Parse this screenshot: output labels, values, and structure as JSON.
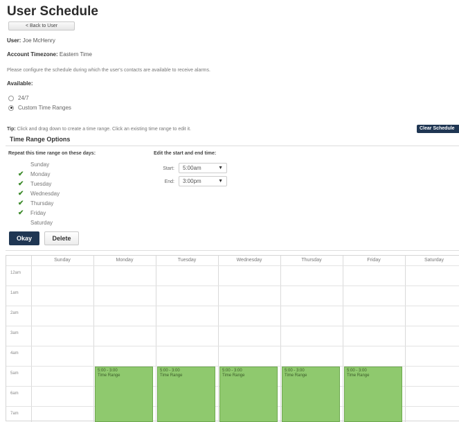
{
  "page": {
    "title": "User Schedule",
    "back_label": "< Back to User",
    "user_label": "User:",
    "user_name": "Joe McHenry",
    "timezone_label": "Account Timezone:",
    "timezone_value": "Eastern Time",
    "description": "Please configure the schedule during which the user's contacts are available to receive alarms.",
    "available_label": "Available:",
    "options": [
      {
        "label": "24/7",
        "selected": false
      },
      {
        "label": "Custom Time Ranges",
        "selected": true
      }
    ]
  },
  "tip": {
    "label": "Tip:",
    "text": "Click and drag down to create a time range. Click an existing time range to edit it.",
    "clear_button": "Clear Schedule"
  },
  "time_range_options": {
    "title": "Time Range Options",
    "repeat_heading": "Repeat this time range on these days:",
    "days": [
      {
        "label": "Sunday",
        "checked": false
      },
      {
        "label": "Monday",
        "checked": true
      },
      {
        "label": "Tuesday",
        "checked": true
      },
      {
        "label": "Wednesday",
        "checked": true
      },
      {
        "label": "Thursday",
        "checked": true
      },
      {
        "label": "Friday",
        "checked": true
      },
      {
        "label": "Saturday",
        "checked": false
      }
    ],
    "edit_heading": "Edit the start and end time:",
    "start_label": "Start:",
    "start_value": "5:00am",
    "end_label": "End:",
    "end_value": "3:00pm",
    "okay_label": "Okay",
    "delete_label": "Delete"
  },
  "calendar": {
    "columns": [
      "Sunday",
      "Monday",
      "Tuesday",
      "Wednesday",
      "Thursday",
      "Friday",
      "Saturday"
    ],
    "hours": [
      "12am",
      "1am",
      "2am",
      "3am",
      "4am",
      "5am",
      "6am",
      "7am"
    ],
    "events": [
      {
        "day": "Monday",
        "time": "5:00 - 3:00",
        "label": "Time Range"
      },
      {
        "day": "Tuesday",
        "time": "5:00 - 3:00",
        "label": "Time Range"
      },
      {
        "day": "Wednesday",
        "time": "5:00 - 3:00",
        "label": "Time Range"
      },
      {
        "day": "Thursday",
        "time": "5:00 - 3:00",
        "label": "Time Range"
      },
      {
        "day": "Friday",
        "time": "5:00 - 3:00",
        "label": "Time Range"
      }
    ]
  },
  "colors": {
    "primary_button": "#1f3653",
    "event_fill": "#8fc96e",
    "check": "#3d8b2b"
  }
}
